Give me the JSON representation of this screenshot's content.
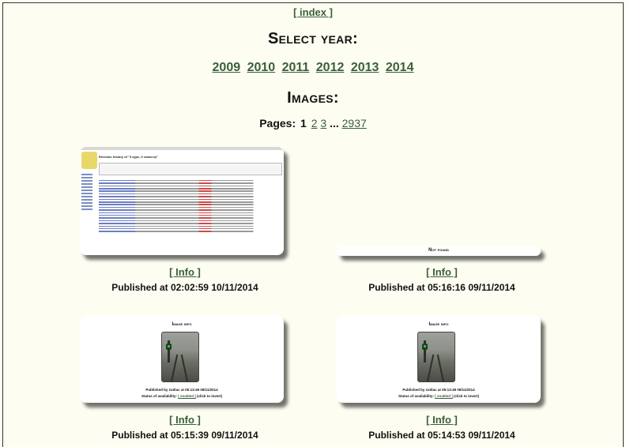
{
  "nav": {
    "index_link": "[ index ]"
  },
  "year_section": {
    "heading": "Select year:",
    "years": [
      "2009",
      "2010",
      "2011",
      "2012",
      "2013",
      "2014"
    ]
  },
  "images_section": {
    "heading": "Images:",
    "pages_label": "Pages:",
    "current_page": "1",
    "page_links": [
      "2",
      "3"
    ],
    "ellipsis": "...",
    "last_page": "2937"
  },
  "items": [
    {
      "thumb_kind": "wiki-screenshot",
      "thumb_title": "Revision history of \"3 курс, 5 семестр\"",
      "info_link": "[ Info ]",
      "published": "Published at 02:02:59 10/11/2014"
    },
    {
      "thumb_kind": "not-found",
      "thumb_text": "Not found",
      "info_link": "[ Info ]",
      "published": "Published at 05:16:16 09/11/2014"
    },
    {
      "thumb_kind": "image-info",
      "thumb_title": "Image info",
      "thumb_pub": "Published by zodiac at 05:13:49 09/11/2014",
      "thumb_status": "Status of availability:",
      "thumb_status_link": "[ enabled ]",
      "thumb_status_hint": "(click to invert)",
      "info_link": "[ Info ]",
      "published": "Published at 05:15:39 09/11/2014"
    },
    {
      "thumb_kind": "image-info",
      "thumb_title": "Image info",
      "thumb_pub": "Published by zodiac at 05:13:49 09/11/2014",
      "thumb_status": "Status of availability:",
      "thumb_status_link": "[ enabled ]",
      "thumb_status_hint": "(click to invert)",
      "info_link": "[ Info ]",
      "published": "Published at 05:14:53 09/11/2014"
    }
  ]
}
